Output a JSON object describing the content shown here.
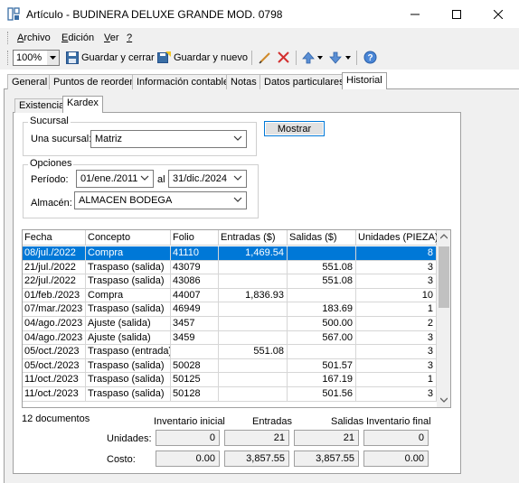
{
  "window": {
    "title": "Artículo - BUDINERA DELUXE GRANDE MOD. 0798"
  },
  "menu": [
    {
      "label": "Archivo",
      "underline": "A",
      "rest": "rchivo"
    },
    {
      "label": "Edición",
      "underline": "E",
      "rest": "dición"
    },
    {
      "label": "Ver",
      "underline": "V",
      "rest": "er"
    },
    {
      "label": "?",
      "underline": "?",
      "rest": ""
    }
  ],
  "toolbar": {
    "zoom": "100%",
    "save_close": "Guardar y cerrar",
    "save_new": "Guardar y nuevo"
  },
  "tabs": [
    "General",
    "Puntos de reorden",
    "Información contable",
    "Notas",
    "Datos particulares",
    "Historial"
  ],
  "active_tab": "Historial",
  "subtabs": [
    "Existencia",
    "Kardex"
  ],
  "active_subtab": "Kardex",
  "sucursal": {
    "group_title": "Sucursal",
    "label": "Una sucursal:",
    "value": "Matriz"
  },
  "opciones": {
    "group_title": "Opciones",
    "periodo_label": "Período:",
    "from": "01/ene./2011",
    "to_label": "al",
    "to": "31/dic./2024",
    "almacen_label": "Almacén:",
    "almacen": "ALMACEN BODEGA"
  },
  "mostrar_button": "Mostrar",
  "grid": {
    "columns": [
      "Fecha",
      "Concepto",
      "Folio",
      "Entradas ($)",
      "Salidas ($)",
      "Unidades (PIEZA)"
    ],
    "rows": [
      [
        "08/jul./2022",
        "Compra",
        "41110",
        "1,469.54",
        "",
        "8"
      ],
      [
        "21/jul./2022",
        "Traspaso (salida)",
        "43079",
        "",
        "551.08",
        "3"
      ],
      [
        "22/jul./2022",
        "Traspaso (salida)",
        "43086",
        "",
        "551.08",
        "3"
      ],
      [
        "01/feb./2023",
        "Compra",
        "44007",
        "1,836.93",
        "",
        "10"
      ],
      [
        "07/mar./2023",
        "Traspaso (salida)",
        "46949",
        "",
        "183.69",
        "1"
      ],
      [
        "04/ago./2023",
        "Ajuste (salida)",
        "3457",
        "",
        "500.00",
        "2"
      ],
      [
        "04/ago./2023",
        "Ajuste (salida)",
        "3459",
        "",
        "567.00",
        "3"
      ],
      [
        "05/oct./2023",
        "Traspaso (entrada)",
        "",
        "551.08",
        "",
        "3"
      ],
      [
        "05/oct./2023",
        "Traspaso (salida)",
        "50028",
        "",
        "501.57",
        "3"
      ],
      [
        "11/oct./2023",
        "Traspaso (salida)",
        "50125",
        "",
        "167.19",
        "1"
      ],
      [
        "11/oct./2023",
        "Traspaso (salida)",
        "50128",
        "",
        "501.56",
        "3"
      ]
    ],
    "selected_row": 0
  },
  "summary": {
    "documents": "12 documentos",
    "headers": [
      "Inventario inicial",
      "Entradas",
      "Salidas",
      "Inventario final"
    ],
    "units_label": "Unidades:",
    "units": [
      "0",
      "21",
      "21",
      "0"
    ],
    "cost_label": "Costo:",
    "cost": [
      "0.00",
      "3,857.55",
      "3,857.55",
      "0.00"
    ]
  }
}
